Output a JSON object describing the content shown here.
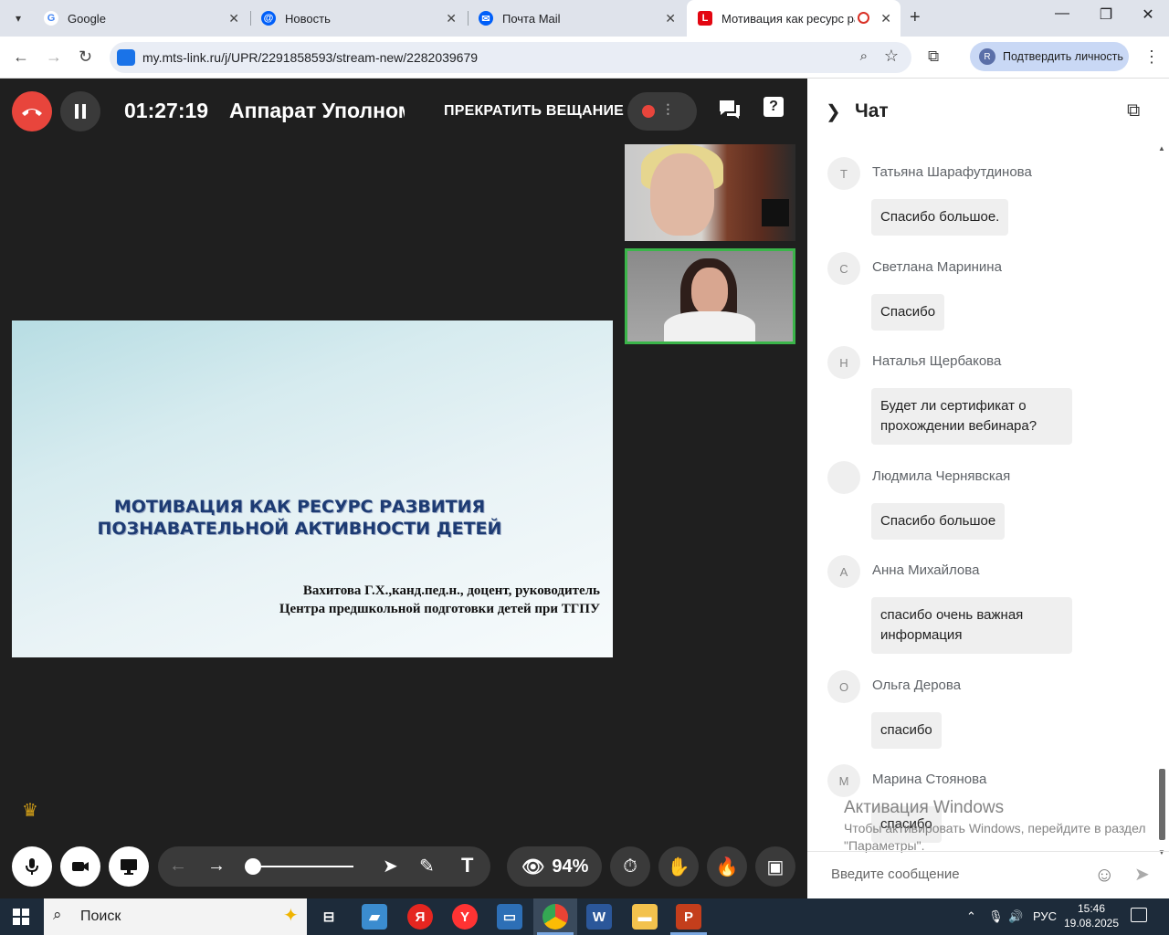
{
  "browser": {
    "tabs": [
      {
        "title": "Google",
        "favicon": "google-icon",
        "color": "#4285f4",
        "letter": "G"
      },
      {
        "title": "Новость",
        "favicon": "mail-at-icon",
        "color": "#005ff9",
        "letter": "@"
      },
      {
        "title": "Почта Mail",
        "favicon": "mail-envelope-icon",
        "color": "#005ff9",
        "letter": "✉"
      },
      {
        "title": "Мотивация как ресурс раз",
        "favicon": "mts-link-icon",
        "color": "#e30611",
        "letter": "L",
        "active": true
      }
    ],
    "url": "my.mts-link.ru/j/UPR/2291858593/stream-new/2282039679",
    "verify_label": "Подтвердить личность",
    "verify_avatar": "R"
  },
  "stream": {
    "timer": "01:27:19",
    "event_title": "Аппарат Уполномоченного",
    "stop_label": "ПРЕКРАТИТЬ ВЕЩАНИЕ",
    "help_symbol": "?",
    "slide": {
      "title_line1": "МОТИВАЦИЯ КАК РЕСУРС РАЗВИТИЯ",
      "title_line2": "ПОЗНАВАТЕЛЬНОЙ АКТИВНОСТИ ДЕТЕЙ",
      "author_line1": "Вахитова Г.Х.,канд.пед.н., доцент, руководитель",
      "author_line2": "Центра предшкольной подготовки детей при ТГПУ"
    },
    "viewers_percent": "94%"
  },
  "chat": {
    "title": "Чат",
    "messages": [
      {
        "initial": "Т",
        "name": "Татьяна Шарафутдинова",
        "text": "Спасибо большое."
      },
      {
        "initial": "С",
        "name": "Светлана Маринина",
        "text": "Спасибо"
      },
      {
        "initial": "Н",
        "name": "Наталья Щербакова",
        "text": "Будет ли сертификат о прохождении вебинара?"
      },
      {
        "initial": "",
        "name": "Людмила Чернявская",
        "text": "Спасибо большое"
      },
      {
        "initial": "А",
        "name": "Анна Михайлова",
        "text": "спасибо очень важная информация"
      },
      {
        "initial": "О",
        "name": "Ольга Дерова",
        "text": "спасибо"
      },
      {
        "initial": "М",
        "name": "Марина Стоянова",
        "text": "спасибо"
      }
    ],
    "input_placeholder": "Введите сообщение",
    "watermark_title": "Активация Windows",
    "watermark_text": "Чтобы активировать Windows, перейдите в раздел \"Параметры\"."
  },
  "taskbar": {
    "search_label": "Поиск",
    "lang": "РУС",
    "time": "15:46",
    "date": "19.08.2025"
  }
}
